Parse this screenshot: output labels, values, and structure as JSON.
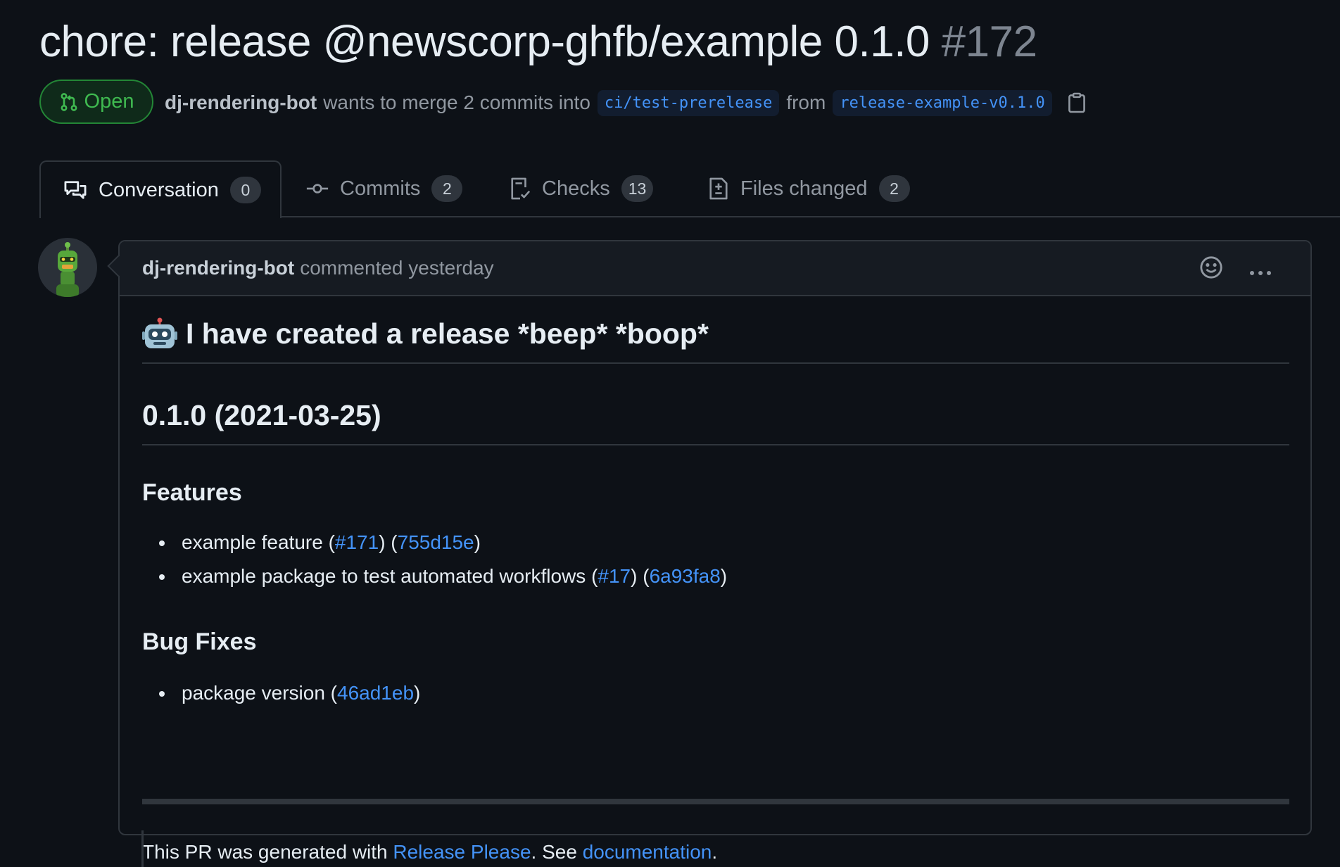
{
  "pr": {
    "title": "chore: release @newscorp-ghfb/example 0.1.0",
    "number": "#172",
    "state": "Open",
    "author": "dj-rendering-bot",
    "merge_text": "wants to merge 2 commits into",
    "base_branch": "ci/test-prerelease",
    "from_text": "from",
    "head_branch": "release-example-v0.1.0"
  },
  "tabs": [
    {
      "label": "Conversation",
      "count": "0",
      "icon": "comment-discussion-icon"
    },
    {
      "label": "Commits",
      "count": "2",
      "icon": "git-commit-icon"
    },
    {
      "label": "Checks",
      "count": "13",
      "icon": "checklist-icon"
    },
    {
      "label": "Files changed",
      "count": "2",
      "icon": "file-diff-icon"
    }
  ],
  "comment": {
    "author": "dj-rendering-bot",
    "meta": "commented yesterday",
    "heading_emoji": "robot-emoji",
    "heading": "I have created a release *beep* *boop*",
    "version_heading": "0.1.0 (2021-03-25)",
    "sections": [
      {
        "title": "Features",
        "items": [
          {
            "text": "example feature (",
            "pr": "#171",
            "mid": ") (",
            "commit": "755d15e",
            "end": ")"
          },
          {
            "text": "example package to test automated workflows (",
            "pr": "#17",
            "mid": ") (",
            "commit": "6a93fa8",
            "end": ")"
          }
        ]
      },
      {
        "title": "Bug Fixes",
        "items": [
          {
            "text": "package version (",
            "commit": "46ad1eb",
            "end": ")"
          }
        ]
      }
    ],
    "footer": {
      "prefix": "This PR was generated with ",
      "link1": "Release Please",
      "middle": ". See ",
      "link2": "documentation",
      "suffix": "."
    }
  },
  "colors": {
    "background": "#0d1117",
    "open_green": "#3fb950",
    "link_blue": "#4493f8",
    "border": "#30363d"
  }
}
